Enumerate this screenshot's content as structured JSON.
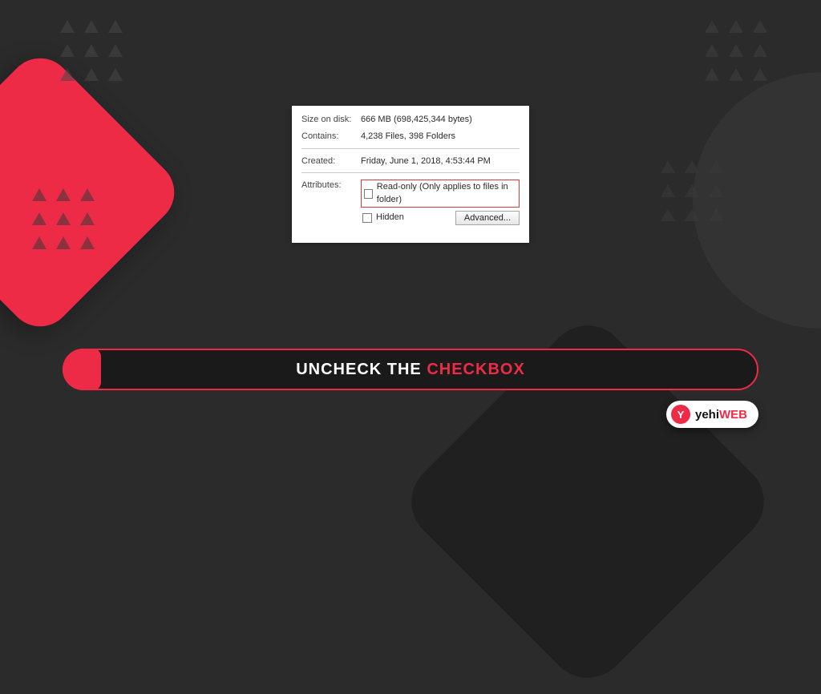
{
  "panel": {
    "size_on_disk_label": "Size on disk:",
    "size_on_disk_value": "666 MB (698,425,344 bytes)",
    "contains_label": "Contains:",
    "contains_value": "4,238 Files, 398 Folders",
    "created_label": "Created:",
    "created_value": "Friday, June 1, 2018, 4:53:44 PM",
    "attributes_label": "Attributes:",
    "readonly_label": "Read-only (Only applies to files in folder)",
    "hidden_label": "Hidden",
    "advanced_button": "Advanced..."
  },
  "caption": {
    "part1": "UNCHECK THE ",
    "part2": "CHECKBOX"
  },
  "badge": {
    "logo_letter": "Y",
    "brand_part1": "yehi",
    "brand_part2": "WEB"
  }
}
